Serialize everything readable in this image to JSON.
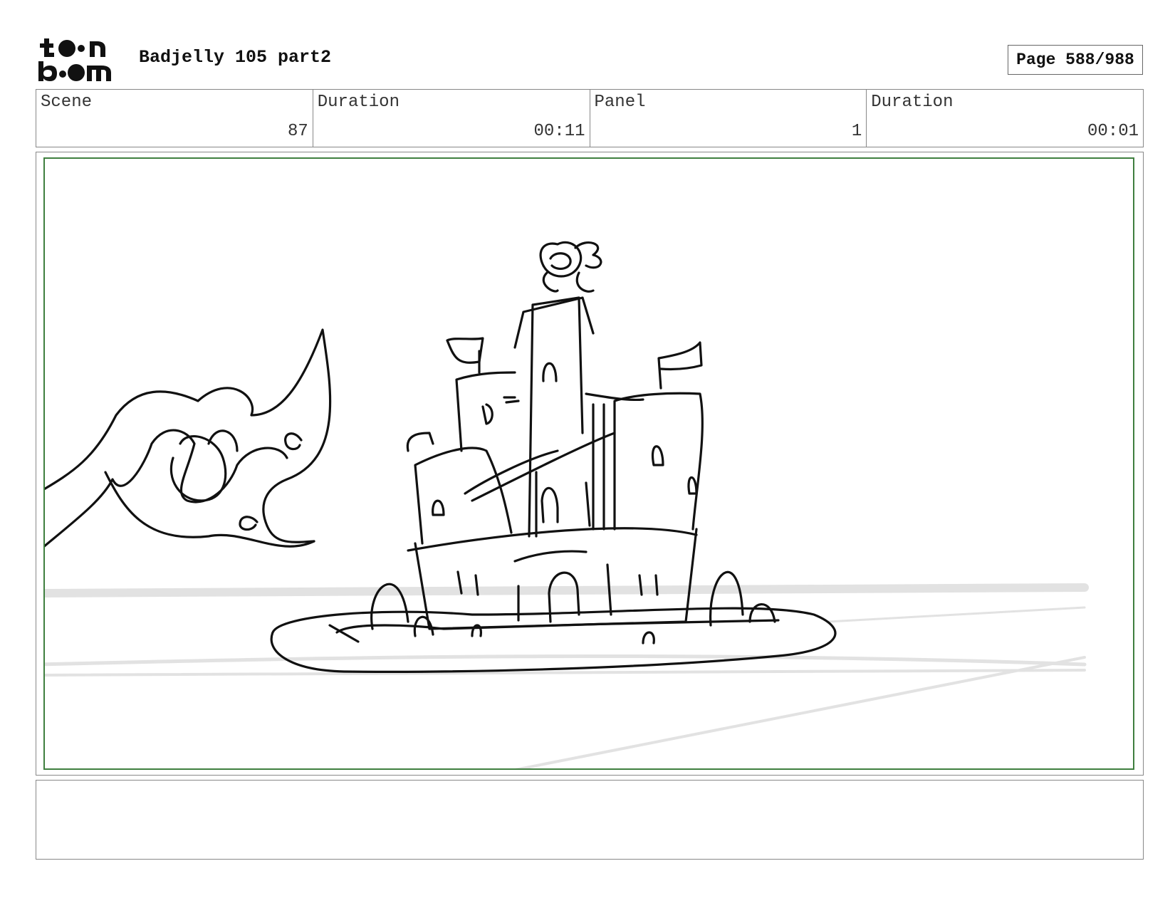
{
  "header": {
    "logo_icon": "toon-boom-logo-icon",
    "title": "Badjelly 105 part2",
    "page_label": "Page 588/988"
  },
  "info": {
    "scene_label": "Scene",
    "scene_value": "87",
    "scene_duration_label": "Duration",
    "scene_duration_value": "00:11",
    "panel_label": "Panel",
    "panel_value": "1",
    "panel_duration_label": "Duration",
    "panel_duration_value": "00:01"
  },
  "panel": {
    "frame_color": "#3f7f3f",
    "sketch_icon": "castle-sketch-icon"
  },
  "notes": {
    "text": ""
  }
}
